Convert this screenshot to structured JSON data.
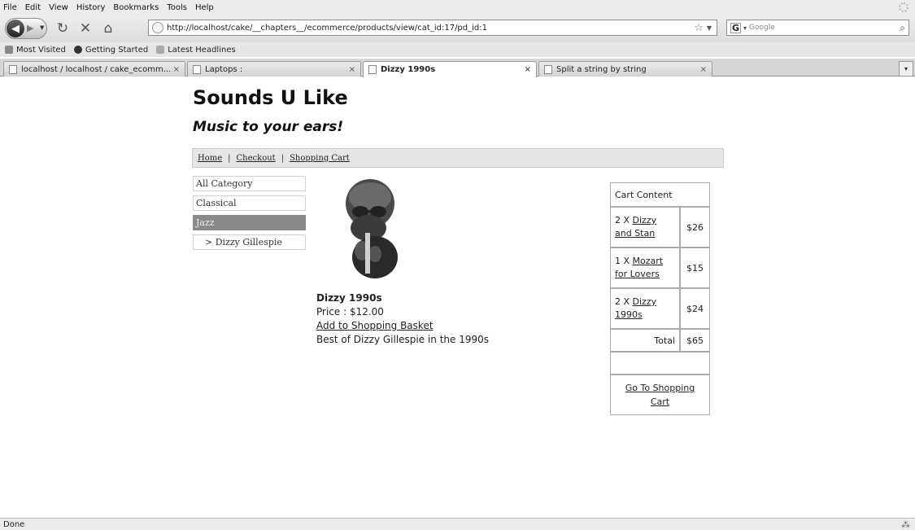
{
  "menu": [
    "File",
    "Edit",
    "View",
    "History",
    "Bookmarks",
    "Tools",
    "Help"
  ],
  "nav": {
    "url": "http://localhost/cake/__chapters__/ecommerce/products/view/cat_id:17/pd_id:1",
    "search_placeholder": "Google"
  },
  "bookmarks": [
    "Most Visited",
    "Getting Started",
    "Latest Headlines"
  ],
  "tabs": [
    {
      "title": "localhost / localhost / cake_ecomm..."
    },
    {
      "title": "Laptops :"
    },
    {
      "title": "Dizzy 1990s"
    },
    {
      "title": "Split a string by string"
    }
  ],
  "site": {
    "title": "Sounds U Like",
    "tagline": "Music to your ears!"
  },
  "breadcrumb": {
    "home": "Home",
    "sep": "|",
    "checkout": "Checkout",
    "cart": "Shopping Cart"
  },
  "categories": [
    {
      "label": "All Category"
    },
    {
      "label": "Classical"
    },
    {
      "label": "Jazz"
    },
    {
      "label": "> Dizzy Gillespie"
    }
  ],
  "product": {
    "name": "Dizzy 1990s",
    "price": "Price : $12.00",
    "add_link": "Add to Shopping Basket",
    "description": "Best of Dizzy Gillespie in the 1990s"
  },
  "cart": {
    "header": "Cart Content",
    "items": [
      {
        "qty": "2 X ",
        "name": "Dizzy and Stan",
        "price": "$26"
      },
      {
        "qty": "1 X ",
        "name": "Mozart for Lovers",
        "price": "$15"
      },
      {
        "qty": "2 X ",
        "name": "Dizzy 1990s",
        "price": "$24"
      }
    ],
    "total_label": "Total",
    "total_value": "$65",
    "goto": "Go To Shopping Cart"
  },
  "status": "Done"
}
